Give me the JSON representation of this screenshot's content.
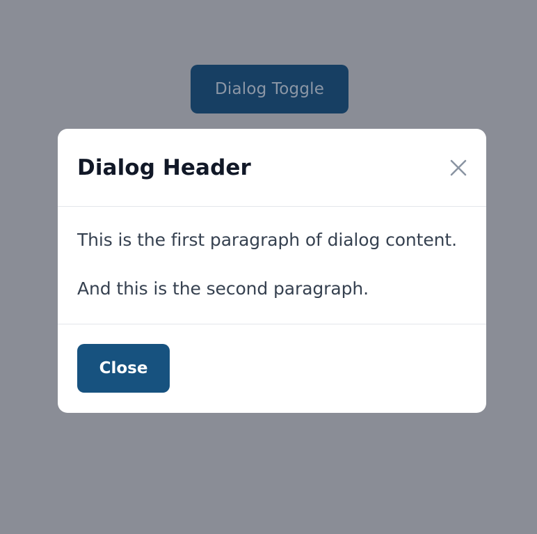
{
  "toggle": {
    "label": "Dialog Toggle"
  },
  "dialog": {
    "title": "Dialog Header",
    "close_icon": "close-icon",
    "paragraphs": [
      "This is the first paragraph of dialog content.",
      "And this is the second paragraph."
    ],
    "close_label": "Close"
  },
  "colors": {
    "backdrop": "#8a8d96",
    "toggle_background": "#173f63",
    "primary_button": "#17527f",
    "title_text": "#111827",
    "body_text": "#364150",
    "divider": "#e3e6ea"
  }
}
